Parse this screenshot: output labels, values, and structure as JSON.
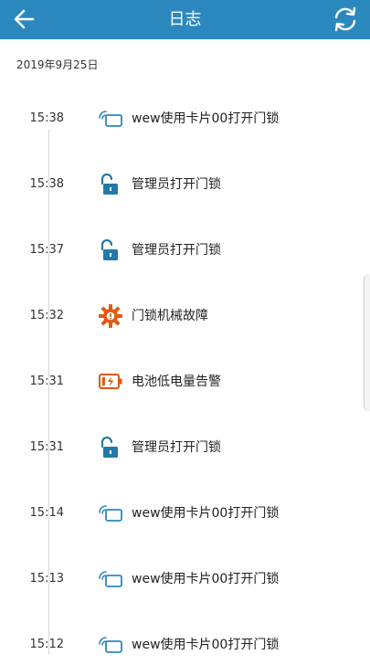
{
  "header": {
    "title": "日志"
  },
  "date_label": "2019年9月25日",
  "logs": [
    {
      "time": "15:38",
      "text": "wew使用卡片00打开门锁",
      "icon": "card-icon"
    },
    {
      "time": "15:38",
      "text": "管理员打开门锁",
      "icon": "unlock-icon"
    },
    {
      "time": "15:37",
      "text": "管理员打开门锁",
      "icon": "unlock-icon"
    },
    {
      "time": "15:32",
      "text": "门锁机械故障",
      "icon": "gear-fault-icon"
    },
    {
      "time": "15:31",
      "text": "电池低电量告警",
      "icon": "low-battery-icon"
    },
    {
      "time": "15:31",
      "text": "管理员打开门锁",
      "icon": "unlock-icon"
    },
    {
      "time": "15:14",
      "text": "wew使用卡片00打开门锁",
      "icon": "card-icon"
    },
    {
      "time": "15:13",
      "text": "wew使用卡片00打开门锁",
      "icon": "card-icon"
    },
    {
      "time": "15:12",
      "text": "wew使用卡片00打开门锁",
      "icon": "card-icon"
    }
  ],
  "colors": {
    "header": "#2b88bf",
    "card_icon": "#2b88bf",
    "unlock_icon": "#2479a8",
    "fault_icon": "#e05a10",
    "battery_icon": "#e05a10"
  }
}
